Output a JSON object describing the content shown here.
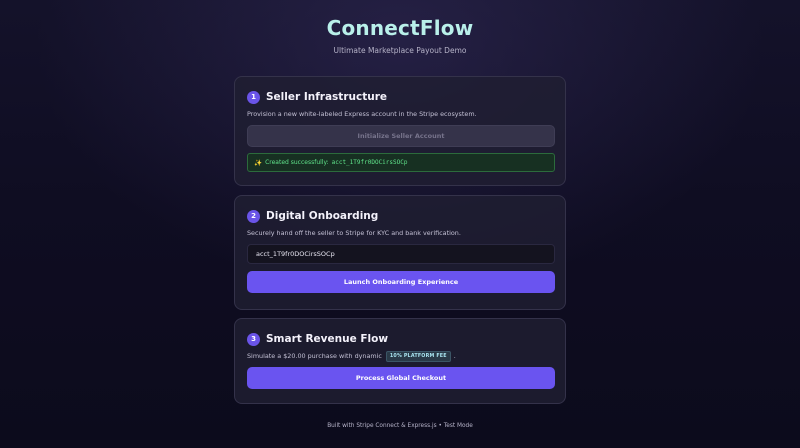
{
  "header": {
    "title": "ConnectFlow",
    "subtitle": "Ultimate Marketplace Payout Demo"
  },
  "steps": [
    {
      "number": "1",
      "title": "Seller Infrastructure",
      "description": "Provision a new white-labeled Express account in the Stripe ecosystem.",
      "button_label": "Initialize Seller Account",
      "button_state": "disabled",
      "success": {
        "icon": "sparkles-icon",
        "prefix": "Created successfully:",
        "account_id": "acct_1T9fr0DOCirsSOCp"
      }
    },
    {
      "number": "2",
      "title": "Digital Onboarding",
      "description": "Securely hand off the seller to Stripe for KYC and bank verification.",
      "input_value": "acct_1T9fr0DOCirsSOCp",
      "button_label": "Launch Onboarding Experience"
    },
    {
      "number": "3",
      "title": "Smart Revenue Flow",
      "description_prefix": "Simulate a $20.00 purchase with dynamic",
      "fee_badge": "10% PLATFORM FEE",
      "description_suffix": ".",
      "button_label": "Process Global Checkout"
    }
  ],
  "footer": {
    "text": "Built with Stripe Connect & Express.js • Test Mode"
  },
  "colors": {
    "accent": "#6a54f0",
    "title": "#b9f0ea",
    "success_text": "#5fe38a",
    "background": "#0f0d22"
  }
}
